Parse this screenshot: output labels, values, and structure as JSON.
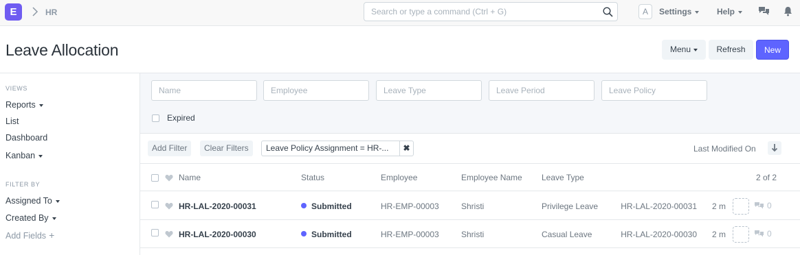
{
  "navbar": {
    "logo_letter": "E",
    "breadcrumb": "HR",
    "search_placeholder": "Search or type a command (Ctrl + G)",
    "avatar_letter": "A",
    "settings_label": "Settings",
    "help_label": "Help"
  },
  "page": {
    "title": "Leave Allocation",
    "menu_label": "Menu",
    "refresh_label": "Refresh",
    "new_label": "New"
  },
  "sidebar": {
    "views_heading": "VIEWS",
    "views": [
      "Reports",
      "List",
      "Dashboard",
      "Kanban"
    ],
    "filter_heading": "FILTER BY",
    "filters": [
      "Assigned To",
      "Created By"
    ],
    "add_fields_label": "Add Fields"
  },
  "filters": {
    "inputs": [
      "Name",
      "Employee",
      "Leave Type",
      "Leave Period",
      "Leave Policy"
    ],
    "expired_label": "Expired",
    "add_filter_label": "Add Filter",
    "clear_filters_label": "Clear Filters",
    "active_filter": "Leave Policy Assignment = HR-...",
    "sort_label": "Last Modified On"
  },
  "list": {
    "columns": [
      "Name",
      "Status",
      "Employee",
      "Employee Name",
      "Leave Type"
    ],
    "count": "2 of 2",
    "rows": [
      {
        "name": "HR-LAL-2020-00031",
        "status": "Submitted",
        "employee": "HR-EMP-00003",
        "employee_name": "Shristi",
        "leave_type": "Privilege Leave",
        "ref": "HR-LAL-2020-00031",
        "modified": "2 m",
        "comments": "0"
      },
      {
        "name": "HR-LAL-2020-00030",
        "status": "Submitted",
        "employee": "HR-EMP-00003",
        "employee_name": "Shristi",
        "leave_type": "Casual Leave",
        "ref": "HR-LAL-2020-00030",
        "modified": "2 m",
        "comments": "0"
      }
    ]
  },
  "colors": {
    "accent": "#5e64ff",
    "status_dot": "#5e64ff"
  }
}
